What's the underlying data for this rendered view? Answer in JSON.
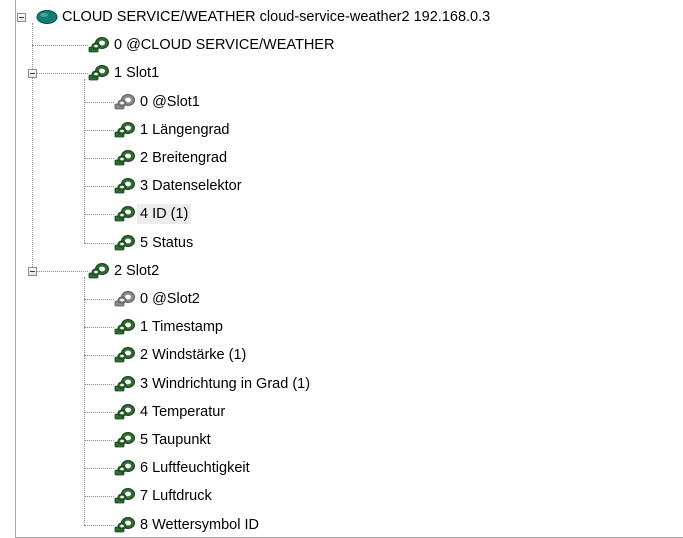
{
  "tree": {
    "root": {
      "label": "CLOUD SERVICE/WEATHER cloud-service-weather2 192.168.0.3",
      "icon": "cloud-icon",
      "children": [
        {
          "label": "0 @CLOUD SERVICE/WEATHER",
          "icon": "connector-icon-green",
          "children": []
        },
        {
          "label": "1 Slot1",
          "icon": "connector-icon-green",
          "expanded": true,
          "children": [
            {
              "label": "0 @Slot1",
              "icon": "connector-icon-gray"
            },
            {
              "label": "1 Längengrad",
              "icon": "connector-icon-green"
            },
            {
              "label": "2 Breitengrad",
              "icon": "connector-icon-green"
            },
            {
              "label": "3 Datenselektor",
              "icon": "connector-icon-green"
            },
            {
              "label": "4 ID (1)",
              "icon": "connector-icon-green",
              "selected": true
            },
            {
              "label": "5 Status",
              "icon": "connector-icon-green"
            }
          ]
        },
        {
          "label": "2 Slot2",
          "icon": "connector-icon-green",
          "expanded": true,
          "children": [
            {
              "label": "0 @Slot2",
              "icon": "connector-icon-gray"
            },
            {
              "label": "1 Timestamp",
              "icon": "connector-icon-green"
            },
            {
              "label": "2 Windstärke (1)",
              "icon": "connector-icon-green"
            },
            {
              "label": "3 Windrichtung in Grad (1)",
              "icon": "connector-icon-green"
            },
            {
              "label": "4 Temperatur",
              "icon": "connector-icon-green"
            },
            {
              "label": "5 Taupunkt",
              "icon": "connector-icon-green"
            },
            {
              "label": "6 Luftfeuchtigkeit",
              "icon": "connector-icon-green"
            },
            {
              "label": "7 Luftdruck",
              "icon": "connector-icon-green"
            },
            {
              "label": "8 Wettersymbol ID",
              "icon": "connector-icon-green"
            }
          ]
        }
      ]
    }
  },
  "colors": {
    "cloud_fill": "#0f7f74",
    "connector_green": "#2f6b33",
    "connector_gray": "#8a8a8a",
    "selection_bg": "#ececec"
  }
}
